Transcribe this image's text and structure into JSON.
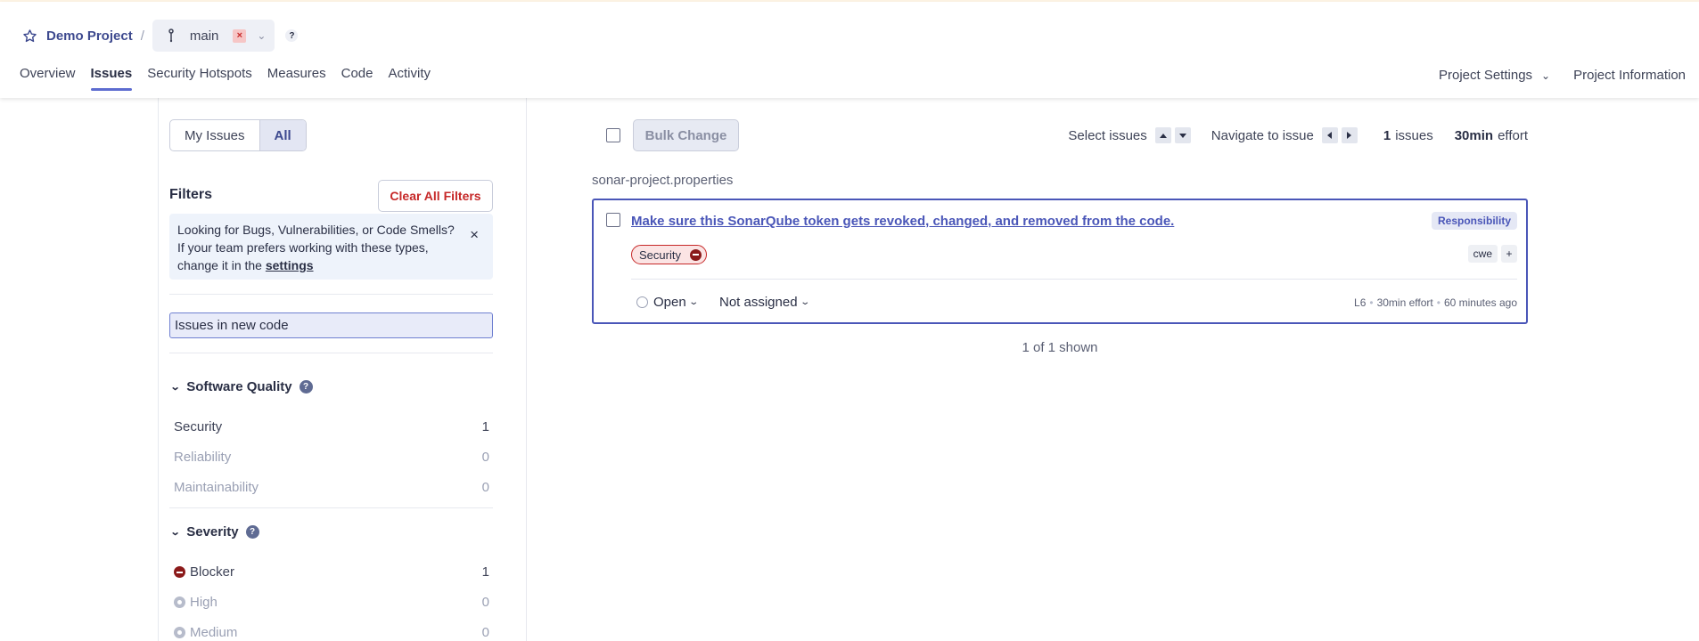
{
  "breadcrumb": {
    "project": "Demo Project",
    "separator": "/",
    "branch": "main",
    "branch_close": "×",
    "help": "?"
  },
  "nav": {
    "tabs": [
      "Overview",
      "Issues",
      "Security Hotspots",
      "Measures",
      "Code",
      "Activity"
    ],
    "active_tab": "Issues",
    "right": {
      "settings": "Project Settings",
      "information": "Project Information"
    }
  },
  "sidebar": {
    "toggle": {
      "my_issues": "My Issues",
      "all": "All"
    },
    "filters_title": "Filters",
    "clear_all": "Clear All Filters",
    "notice": {
      "text": "Looking for Bugs, Vulnerabilities, or Code Smells? If your team prefers working with these types, change it in the ",
      "link": "settings",
      "close": "×"
    },
    "new_code": "Issues in new code",
    "software_quality": {
      "title": "Software Quality",
      "items": [
        {
          "label": "Security",
          "count": "1"
        },
        {
          "label": "Reliability",
          "count": "0"
        },
        {
          "label": "Maintainability",
          "count": "0"
        }
      ]
    },
    "severity": {
      "title": "Severity",
      "items": [
        {
          "label": "Blocker",
          "count": "1"
        },
        {
          "label": "High",
          "count": "0"
        },
        {
          "label": "Medium",
          "count": "0"
        }
      ]
    }
  },
  "toolbar": {
    "bulk_change": "Bulk Change",
    "select_issues": "Select issues",
    "navigate_issue": "Navigate to issue",
    "issues_count": "1",
    "issues_label": "issues",
    "effort_value": "30min",
    "effort_label": "effort"
  },
  "issue_list": {
    "filename": "sonar-project.properties",
    "issue": {
      "title": "Make sure this SonarQube token gets revoked, changed, and removed from the code.",
      "attribute": "Responsibility",
      "quality": "Security",
      "tags": [
        "cwe"
      ],
      "tag_add": "+",
      "status": "Open",
      "assignee": "Not assigned",
      "line": "L6",
      "effort": "30min effort",
      "age": "60 minutes ago"
    },
    "shown": "1 of 1 shown"
  },
  "colors": {
    "accent": "#4a56b8",
    "danger": "#c62828",
    "blocker": "#8b1a1a"
  }
}
